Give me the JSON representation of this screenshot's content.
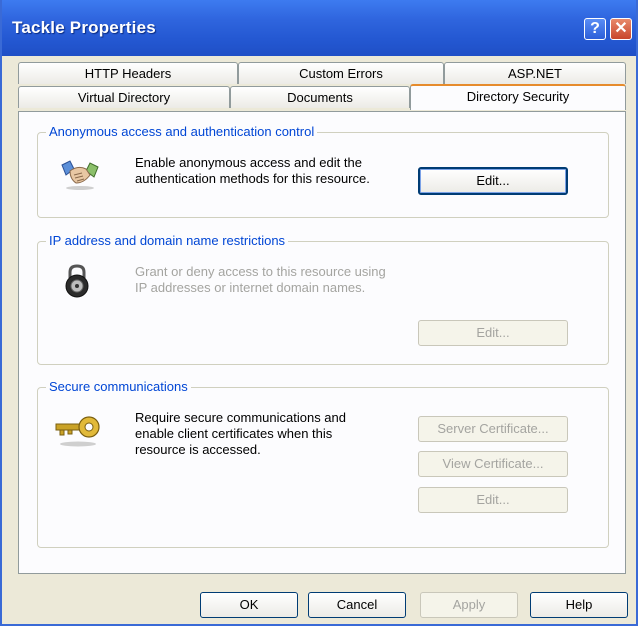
{
  "window": {
    "title": "Tackle Properties",
    "help_glyph": "?",
    "close_glyph": "✕"
  },
  "tabs": {
    "row1": [
      "HTTP Headers",
      "Custom Errors",
      "ASP.NET"
    ],
    "row2": [
      "Virtual Directory",
      "Documents",
      "Directory Security"
    ],
    "active": "Directory Security"
  },
  "anon": {
    "legend": "Anonymous access and authentication control",
    "line1": "Enable anonymous access and edit the",
    "line2": "authentication methods for this resource.",
    "edit": "Edit..."
  },
  "ip": {
    "legend": "IP address and domain name restrictions",
    "line1": "Grant or deny access to this resource using",
    "line2": "IP addresses or internet domain names.",
    "edit": "Edit..."
  },
  "secure": {
    "legend": "Secure communications",
    "line1": "Require secure communications and",
    "line2": "enable client certificates when this",
    "line3": "resource is accessed.",
    "server_cert": "Server Certificate...",
    "view_cert": "View Certificate...",
    "edit": "Edit..."
  },
  "footer": {
    "ok": "OK",
    "cancel": "Cancel",
    "apply": "Apply",
    "help": "Help"
  }
}
